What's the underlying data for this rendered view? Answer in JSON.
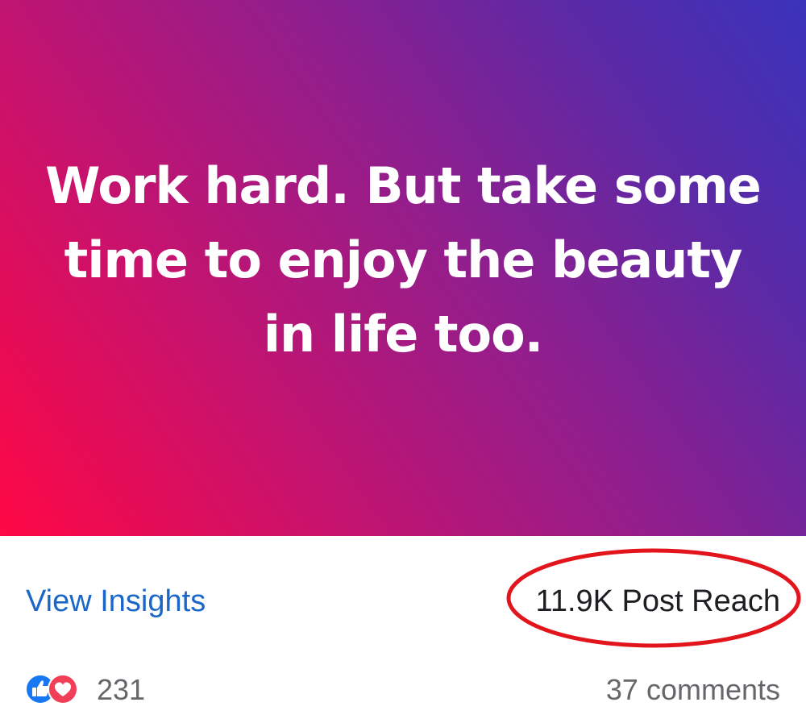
{
  "post": {
    "message": "Work hard. But take some time to enjoy the beauty in life too.",
    "background_gradient": [
      "#ff0845",
      "#c4136f",
      "#8d1f8f",
      "#5a2aa6",
      "#3a33bb"
    ],
    "text_color": "#ffffff"
  },
  "insights": {
    "view_label": "View Insights",
    "view_color": "#1a66c9",
    "reach_label": "11.9K Post Reach",
    "highlight_color": "#e2141c"
  },
  "engagement": {
    "reaction_icons": [
      "like-icon",
      "love-icon"
    ],
    "reaction_count": "231",
    "comments_label": "37 comments"
  }
}
